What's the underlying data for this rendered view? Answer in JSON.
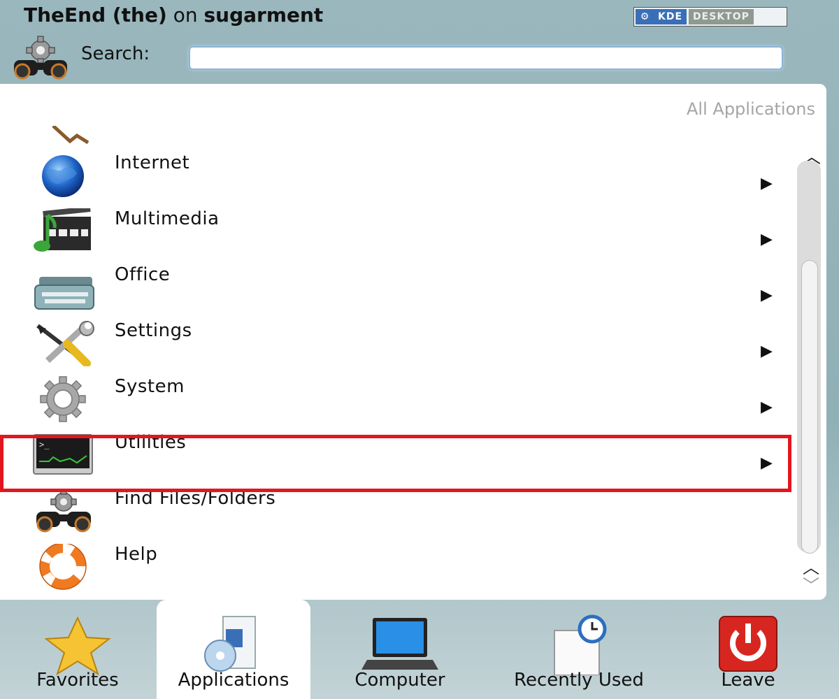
{
  "header": {
    "user_name": "TheEnd (the)",
    "on_text": "on",
    "host_name": "sugarment",
    "badge_kde": "KDE",
    "badge_desktop": "DESKTOP"
  },
  "search": {
    "label": "Search:",
    "placeholder": "",
    "value": ""
  },
  "breadcrumb": "All Applications",
  "menu_items": [
    {
      "label": "Internet",
      "icon": "globe-icon"
    },
    {
      "label": "Multimedia",
      "icon": "multimedia-icon"
    },
    {
      "label": "Office",
      "icon": "typewriter-icon"
    },
    {
      "label": "Settings",
      "icon": "tools-icon"
    },
    {
      "label": "System",
      "icon": "gear-icon"
    },
    {
      "label": "Utilities",
      "icon": "terminal-icon"
    },
    {
      "label": "Find Files/Folders",
      "icon": "binoculars-icon"
    },
    {
      "label": "Help",
      "icon": "lifebuoy-icon"
    }
  ],
  "submenu_arrow": "▶",
  "tabs": [
    {
      "label": "Favorites",
      "icon": "star-icon"
    },
    {
      "label": "Applications",
      "icon": "applications-icon"
    },
    {
      "label": "Computer",
      "icon": "laptop-icon"
    },
    {
      "label": "Recently Used",
      "icon": "clock-document-icon"
    },
    {
      "label": "Leave",
      "icon": "power-icon"
    }
  ],
  "colors": {
    "highlight": "#e3161e",
    "accent": "#3a6fb8"
  }
}
